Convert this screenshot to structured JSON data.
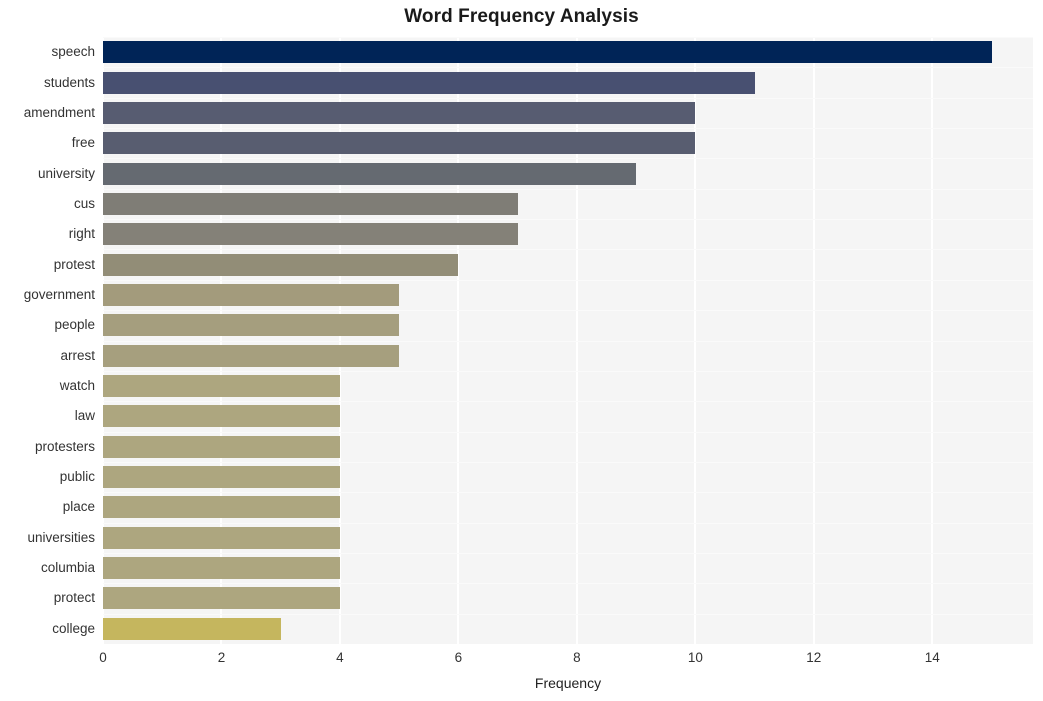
{
  "chart_data": {
    "type": "bar",
    "orientation": "horizontal",
    "title": "Word Frequency Analysis",
    "xlabel": "Frequency",
    "ylabel": "",
    "categories": [
      "speech",
      "students",
      "amendment",
      "free",
      "university",
      "cus",
      "right",
      "protest",
      "government",
      "people",
      "arrest",
      "watch",
      "law",
      "protesters",
      "public",
      "place",
      "universities",
      "columbia",
      "protect",
      "college"
    ],
    "values": [
      15,
      11,
      10,
      10,
      9,
      7,
      7,
      6,
      5,
      5,
      5,
      4,
      4,
      4,
      4,
      4,
      4,
      4,
      4,
      3
    ],
    "xlim": [
      0,
      15.7
    ],
    "xticks": [
      0,
      2,
      4,
      6,
      8,
      10,
      12,
      14
    ],
    "xticklabels": [
      "0",
      "2",
      "4",
      "6",
      "8",
      "10",
      "12",
      "14"
    ],
    "grid": true,
    "legend": null,
    "colormap": "cividis",
    "bar_colors": [
      "#002457",
      "#485071",
      "#575c71",
      "#585d70",
      "#656a71",
      "#7f7d76",
      "#848178",
      "#928d77",
      "#a39b7c",
      "#a59e7e",
      "#a69f7e",
      "#ada67f",
      "#ada67f",
      "#ada67f",
      "#ada67f",
      "#ada67f",
      "#ada67f",
      "#ada67f",
      "#ada67f",
      "#c5b65e"
    ],
    "plot_background": "#f5f5f5",
    "grid_color": "#ffffff",
    "figure_background": "#ffffff"
  }
}
